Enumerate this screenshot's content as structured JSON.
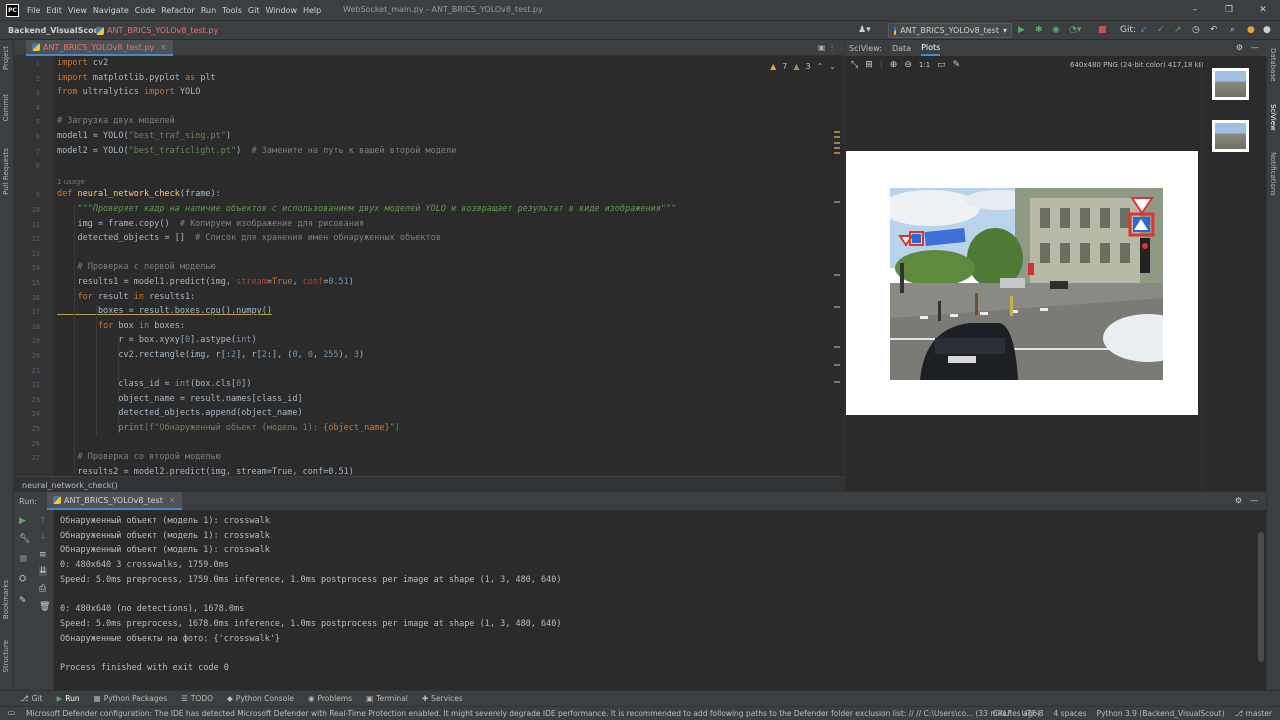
{
  "titlebar": {
    "logo": "PC",
    "menu": [
      "File",
      "Edit",
      "View",
      "Navigate",
      "Code",
      "Refactor",
      "Run",
      "Tools",
      "Git",
      "Window",
      "Help"
    ],
    "title": "WebSocket_main.py - ANT_BRICS_YOLOv8_test.py",
    "win_min": "–",
    "win_max": "❐",
    "win_close": "✕"
  },
  "navbar": {
    "project": "Backend_VisualScout",
    "file": "ANT_BRICS_YOLOv8_test.py",
    "run_config": "ANT_BRICS_YOLOv8_test",
    "git_label": "Git:"
  },
  "editor": {
    "tab": "ANT_BRICS_YOLOv8_test.py",
    "warnings": "7",
    "weak": "3",
    "line_numbers": [
      "1",
      "2",
      "3",
      "4",
      "5",
      "6",
      "7",
      "8",
      "9",
      "10",
      "11",
      "12",
      "13",
      "14",
      "15",
      "16",
      "17",
      "18",
      "19",
      "20",
      "21",
      "22",
      "23",
      "24",
      "25",
      "26",
      "27"
    ],
    "usage_hint": "1 usage",
    "lines": {
      "l1a": "import",
      "l1b": " cv2",
      "l2a": "import",
      "l2b": " matplotlib.pyplot ",
      "l2c": "as",
      "l2d": " plt",
      "l3a": "from",
      "l3b": " ultralytics ",
      "l3c": "import",
      "l3d": " YOLO",
      "l5": "# Загрузка двух моделей",
      "l6a": "model1 = YOLO(",
      "l6b": "\"best_traf_sing.pt\"",
      "l6c": ")",
      "l7a": "model2 = YOLO(",
      "l7b": "\"best_traficlight.pt\"",
      "l7c": ")  ",
      "l7d": "# Замените на путь к вашей второй модели",
      "l9a": "def ",
      "l9b": "neural_network_check",
      "l9c": "(frame):",
      "l10": "    \"\"\"Проверяет кадр на наличие объектов с использованием двух моделей YOLO и возвращает результат в виде изображения\"\"\"",
      "l11a": "    img = frame.copy()  ",
      "l11b": "# Копируем изображение для рисования",
      "l12a": "    detected_objects = []  ",
      "l12b": "# Список для хранения имен обнаруженных объектов",
      "l14": "    # Проверка с первой моделью",
      "l15a": "    results1 = model1.predict(img, ",
      "l15b": "stream",
      "l15c": "=",
      "l15d": "True",
      ", ": ", ",
      "l15e": "conf",
      "l15f": "=",
      "l15g": "0.51",
      "l15h": ")",
      "l16a": "    ",
      "l16b": "for",
      "l16c": " result ",
      "l16d": "in",
      "l16e": " results1:",
      "l17": "        boxes = result.boxes.cpu().numpy()",
      "l18a": "        ",
      "l18b": "for",
      "l18c": " box ",
      "l18d": "in",
      "l18e": " boxes:",
      "l19a": "            r = box.xyxy[",
      "l19b": "0",
      "l19c": "].astype(",
      "l19d": "int",
      ")": ")",
      "l20a": "            cv2.rectangle(img, r[:",
      "l20b": "2",
      "l20c": "], r[",
      "l20d": "2",
      "l20e": ":], (",
      "l20f": "0",
      ", 0": ", ",
      "l20g": "0",
      "l20h": ", ",
      "l20i": "255",
      "l20j": "), ",
      "l20k": "3",
      "l20l": ")",
      "l22a": "            class_id = ",
      "l22b": "int",
      "l22c": "(box.cls[",
      "l22d": "0",
      "l22e": "])",
      "l23": "            object_name = result.names[class_id]",
      "l24": "            detected_objects.append(object_name)",
      "l25a": "            ",
      "l25b": "print",
      "l25c": "(f\"Обнаруженный объект (модель 1): ",
      "l25d": "{object_name}",
      "l25e": "\")",
      "l27": "    # Проверка со второй моделью",
      "l28": "    results2 = model2.predict(img, stream=True, conf=0.51)"
    },
    "breadcrumb": "neural_network_check()"
  },
  "sciview": {
    "label": "SciView:",
    "tabs": [
      "Data",
      "Plots"
    ],
    "image_info": "640x480 PNG (24-bit color) 417,18 kB",
    "zoom": "1:1"
  },
  "run": {
    "label": "Run:",
    "tab": "ANT_BRICS_YOLOv8_test",
    "console": [
      "Обнаруженный объект (модель 1): crosswalk",
      "Обнаруженный объект (модель 1): crosswalk",
      "Обнаруженный объект (модель 1): crosswalk",
      "0: 480x640 3 crosswalks, 1759.0ms",
      "Speed: 5.0ms preprocess, 1759.0ms inference, 1.0ms postprocess per image at shape (1, 3, 480, 640)",
      "",
      "0: 480x640 (no detections), 1678.0ms",
      "Speed: 5.0ms preprocess, 1678.0ms inference, 1.0ms postprocess per image at shape (1, 3, 480, 640)",
      "Обнаруженные объекты на фото: {'crosswalk'}",
      "",
      "Process finished with exit code 0"
    ]
  },
  "side_left": [
    "Project",
    "Commit",
    "Pull Requests",
    "Bookmarks",
    "Structure"
  ],
  "side_right": [
    "Database",
    "SciView",
    "Notifications"
  ],
  "bottom_tabs": [
    "Git",
    "Run",
    "Python Packages",
    "TODO",
    "Python Console",
    "Problems",
    "Terminal",
    "Services"
  ],
  "status": {
    "message": "Microsoft Defender configuration: The IDE has detected Microsoft Defender with Real-Time Protection enabled. It might severely degrade IDE performance. It is recommended to add following paths to the Defender folder exclusion list: // // C:\\Users\\co... (33 minutes ago)",
    "crlf": "CRLF",
    "encoding": "UTF-8",
    "indent": "4 spaces",
    "interpreter": "Python 3.9 (Backend_VisualScout)",
    "branch": "master"
  },
  "colors": {
    "accent": "#4a88c7",
    "keyword": "#cc7832",
    "string": "#6a8759",
    "comment": "#808080"
  }
}
